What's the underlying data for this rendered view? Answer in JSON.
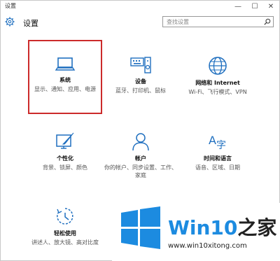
{
  "window": {
    "title": "设置",
    "controls": {
      "minimize": "—",
      "maximize": "☐",
      "close": "✕"
    }
  },
  "header": {
    "title": "设置",
    "search_placeholder": "查找设置"
  },
  "tiles": [
    {
      "label": "系统",
      "desc": "显示、通知、应用、电源",
      "icon": "laptop-icon"
    },
    {
      "label": "设备",
      "desc": "蓝牙、打印机、鼠标",
      "icon": "devices-icon"
    },
    {
      "label": "网络和 Internet",
      "desc": "Wi-Fi、飞行模式、VPN",
      "icon": "globe-icon"
    },
    {
      "label": "个性化",
      "desc": "背景、锁屏、颜色",
      "icon": "personalize-icon"
    },
    {
      "label": "帐户",
      "desc": "你的帐户、同步设置、工作、家庭",
      "icon": "account-icon"
    },
    {
      "label": "时间和语言",
      "desc": "语音、区域、日期",
      "icon": "time-language-icon"
    },
    {
      "label": "轻松使用",
      "desc": "讲述人、放大镜、高对比度",
      "icon": "ease-of-access-icon"
    }
  ],
  "brand": {
    "name_latin": "Win10",
    "name_cn": "之家",
    "url": "www.win10xitong.com"
  },
  "colors": {
    "accent": "#1f6fbf",
    "selection": "#cc2b2b",
    "brand": "#1c8be0"
  }
}
